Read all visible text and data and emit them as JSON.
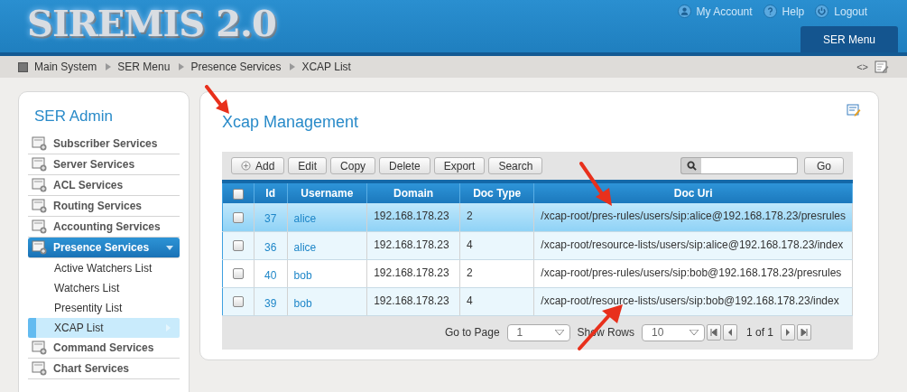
{
  "header": {
    "logo": "SIREMIS 2.0",
    "links": [
      {
        "label": "My Account",
        "kind": "user"
      },
      {
        "label": "Help",
        "kind": "help"
      },
      {
        "label": "Logout",
        "kind": "power"
      }
    ],
    "menu_tab": "SER Menu"
  },
  "breadcrumb": {
    "items": [
      "Main System",
      "SER Menu",
      "Presence Services",
      "XCAP List"
    ],
    "toggle": "<>"
  },
  "sidebar": {
    "title": "SER Admin",
    "items": [
      {
        "label": "Subscriber Services",
        "expanded": false
      },
      {
        "label": "Server Services",
        "expanded": false
      },
      {
        "label": "ACL Services",
        "expanded": false
      },
      {
        "label": "Routing Services",
        "expanded": false
      },
      {
        "label": "Accounting Services",
        "expanded": false
      },
      {
        "label": "Presence Services",
        "expanded": true,
        "children": [
          {
            "label": "Active Watchers List",
            "selected": false
          },
          {
            "label": "Watchers List",
            "selected": false
          },
          {
            "label": "Presentity List",
            "selected": false
          },
          {
            "label": "XCAP List",
            "selected": true
          }
        ]
      },
      {
        "label": "Command Services",
        "expanded": false
      },
      {
        "label": "Chart Services",
        "expanded": false
      }
    ]
  },
  "main": {
    "title": "Xcap Management",
    "toolbar": [
      "Add",
      "Edit",
      "Copy",
      "Delete",
      "Export",
      "Search"
    ],
    "go": "Go",
    "table": {
      "header_checked": false,
      "columns": [
        "Id",
        "Username",
        "Domain",
        "Doc Type",
        "Doc Uri"
      ],
      "rows": [
        {
          "checked": false,
          "selected": true,
          "cells": [
            "37",
            "alice",
            "192.168.178.23",
            "2",
            "/xcap-root/pres-rules/users/sip:alice@192.168.178.23/presrules"
          ]
        },
        {
          "checked": false,
          "selected": false,
          "cells": [
            "36",
            "alice",
            "192.168.178.23",
            "4",
            "/xcap-root/resource-lists/users/sip:alice@192.168.178.23/index"
          ]
        },
        {
          "checked": false,
          "selected": false,
          "cells": [
            "40",
            "bob",
            "192.168.178.23",
            "2",
            "/xcap-root/pres-rules/users/sip:bob@192.168.178.23/presrules"
          ]
        },
        {
          "checked": false,
          "selected": false,
          "cells": [
            "39",
            "bob",
            "192.168.178.23",
            "4",
            "/xcap-root/resource-lists/users/sip:bob@192.168.178.23/index"
          ]
        }
      ]
    },
    "pager": {
      "page_label": "Go to Page",
      "page": "1",
      "rows_label": "Show Rows",
      "rows": "10",
      "info": "1 of 1"
    }
  }
}
